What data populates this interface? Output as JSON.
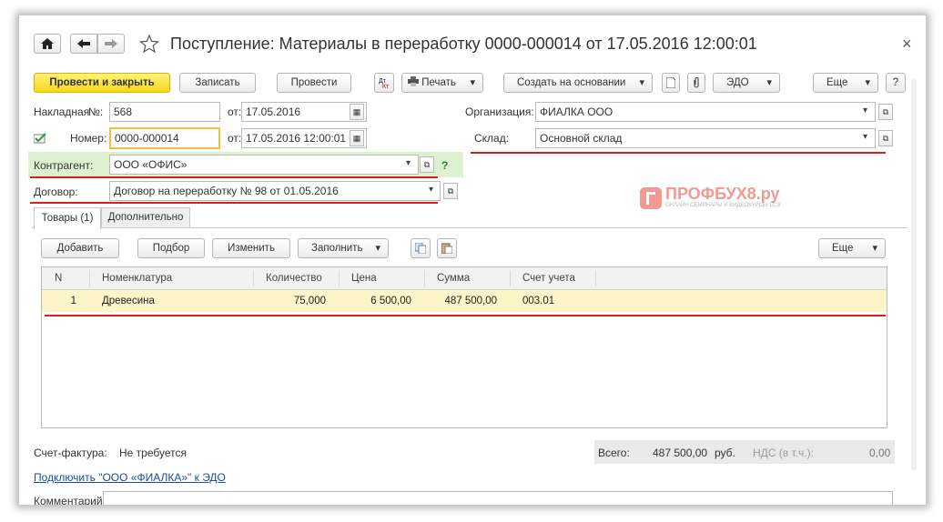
{
  "title_bar": {
    "title": "Поступление: Материалы в переработку 0000-000014 от 17.05.2016 12:00:01",
    "home_icon": "home-icon",
    "back_icon": "arrow-left-icon",
    "forward_icon": "arrow-right-icon",
    "star_icon": "star-icon",
    "close_glyph": "×"
  },
  "toolbar": {
    "post_close": "Провести и закрыть",
    "save": "Записать",
    "post": "Провести",
    "print": "Печать",
    "create_based": "Создать на основании",
    "edo": "ЭДО",
    "more": "Еще",
    "help": "?"
  },
  "form": {
    "invoice_label": "Накладная",
    "invoice_no_label": "№:",
    "invoice_no": "568",
    "from_label": "от:",
    "invoice_date": "17.05.2016",
    "number_label": "Номер:",
    "number_value": "0000-000014",
    "number_date": "17.05.2016 12:00:01",
    "org_label": "Организация:",
    "org_value": "ФИАЛКА ООО",
    "warehouse_label": "Склад:",
    "warehouse_value": "Основной склад",
    "contractor_label": "Контрагент:",
    "contractor_value": "ООО «ОФИС»",
    "contract_label": "Договор:",
    "contract_value": "Договор на переработку № 98 от 01.05.2016",
    "help_mark": "?"
  },
  "watermark": {
    "brand": "ПРОФБУХ8.ру",
    "tagline": "ОНЛАЙН СЕМИНАРЫ И ВИДЕОКУРСЫ 1С:8"
  },
  "tabs": [
    {
      "label": "Товары (1)"
    },
    {
      "label": "Дополнительно"
    }
  ],
  "table_toolbar": {
    "add": "Добавить",
    "select": "Подбор",
    "change": "Изменить",
    "fill": "Заполнить",
    "more": "Еще"
  },
  "table": {
    "columns": [
      "N",
      "Номенклатура",
      "Количество",
      "Цена",
      "Сумма",
      "Счет учета"
    ],
    "rows": [
      {
        "n": "1",
        "item": "Древесина",
        "qty": "75,000",
        "price": "6 500,00",
        "sum": "487 500,00",
        "account": "003.01"
      }
    ]
  },
  "footer": {
    "invoice_label": "Счет-фактура:",
    "invoice_value": "Не требуется",
    "total_label": "Всего:",
    "total_value": "487 500,00",
    "currency": "руб.",
    "vat_label": "НДС (в т.ч.):",
    "vat_value": "0,00",
    "edo_link": "Подключить \"ООО «ФИАЛКА»\" к ЭДО",
    "comment_label": "Комментарий:"
  },
  "colors": {
    "accent_yellow": "#f7d81a",
    "row_highlight": "#fdf5c8",
    "contractor_bg": "#ddf0cf",
    "underline_red": "#d81e1e",
    "watermark_red": "#e8574b"
  }
}
